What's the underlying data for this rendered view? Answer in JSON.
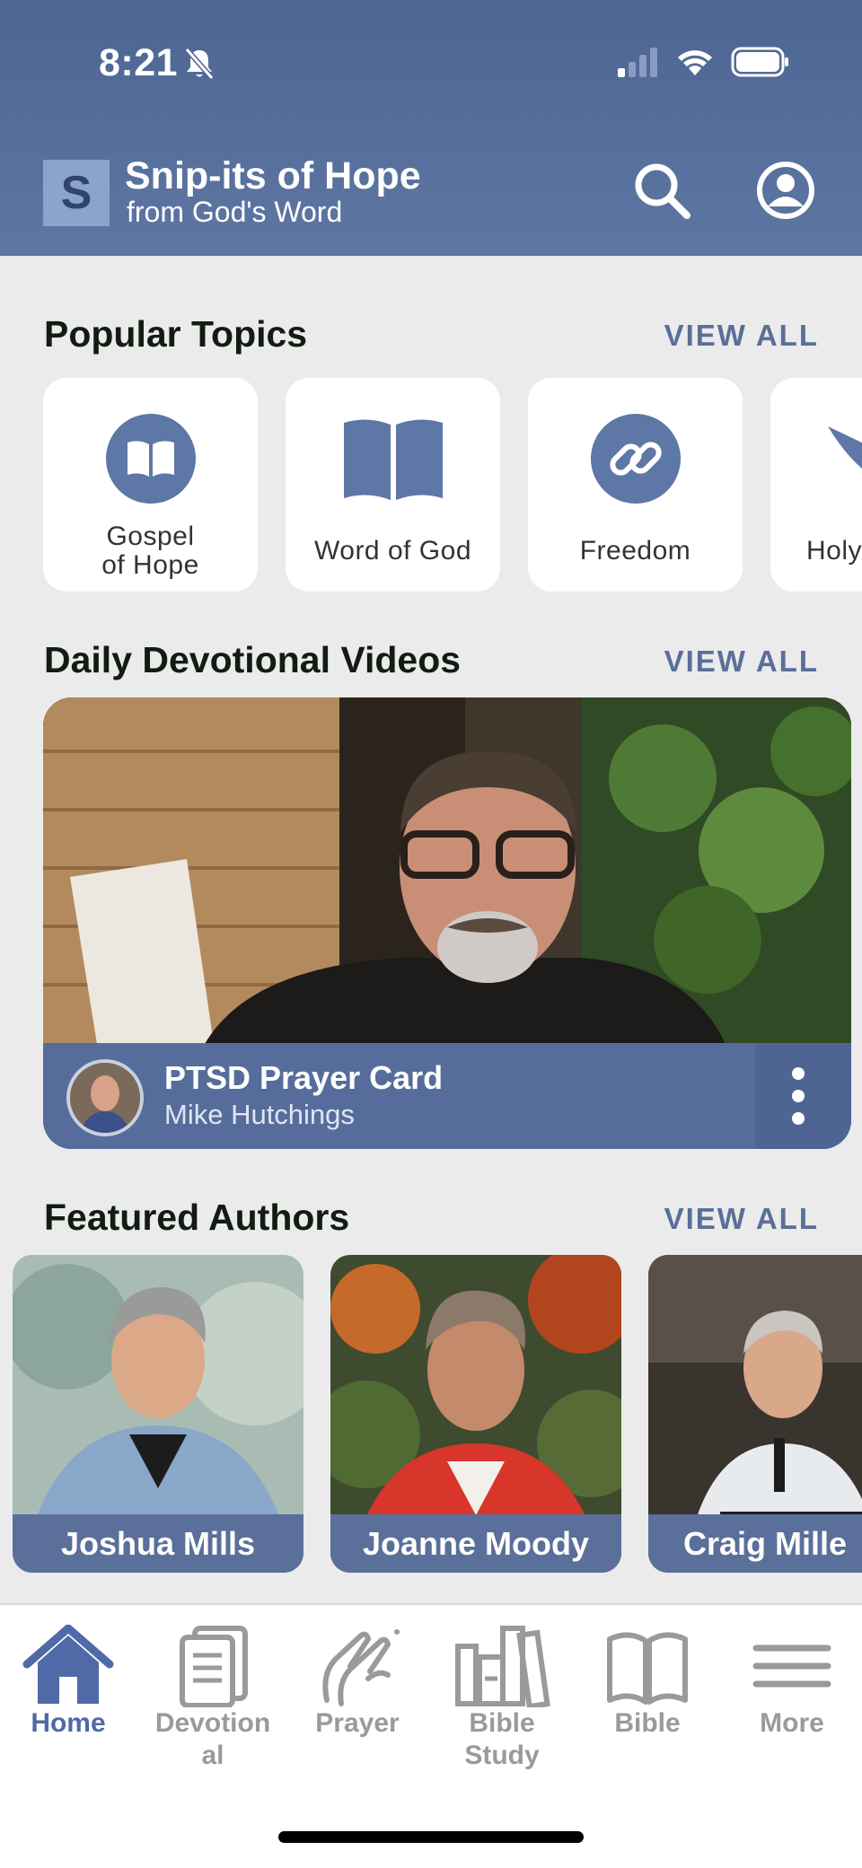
{
  "status_bar": {
    "time": "8:21"
  },
  "header": {
    "logo_letter": "S",
    "title": "Snip-its of Hope",
    "subtitle": "from God's Word"
  },
  "popular_topics": {
    "title": "Popular Topics",
    "view_all": "VIEW ALL",
    "items": [
      {
        "label_line1": "Gospel",
        "label_line2": "of Hope",
        "icon": "open-book-circle-icon"
      },
      {
        "label": "Word of God",
        "icon": "bible-book-icon"
      },
      {
        "label": "Freedom",
        "icon": "chain-link-circle-icon"
      },
      {
        "label": "Holy",
        "icon": "dove-icon"
      }
    ]
  },
  "daily_videos": {
    "title": "Daily Devotional Videos",
    "view_all": "VIEW ALL",
    "video": {
      "title": "PTSD Prayer Card",
      "author": "Mike Hutchings"
    }
  },
  "featured_authors": {
    "title": "Featured Authors",
    "view_all": "VIEW ALL",
    "items": [
      {
        "name": "Joshua Mills"
      },
      {
        "name": "Joanne Moody"
      },
      {
        "name": "Craig Mille"
      }
    ]
  },
  "tab_bar": {
    "items": [
      {
        "label": "Home",
        "icon": "home-icon",
        "active": true
      },
      {
        "label_line1": "Devotion",
        "label_line2": "al",
        "icon": "document-icon"
      },
      {
        "label": "Prayer",
        "icon": "praying-hands-icon"
      },
      {
        "label_line1": "Bible",
        "label_line2": "Study",
        "icon": "books-icon"
      },
      {
        "label": "Bible",
        "icon": "open-book-icon"
      },
      {
        "label": "More",
        "icon": "menu-icon"
      }
    ]
  },
  "colors": {
    "header": "#4d6593",
    "accent": "#5a6f98",
    "active_tab": "#4f6aa6",
    "background": "#ebebeb"
  }
}
